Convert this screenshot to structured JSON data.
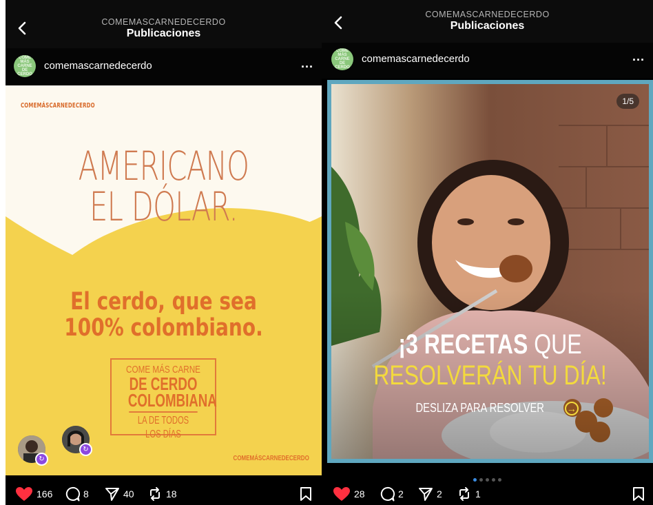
{
  "left": {
    "header": {
      "subtitle": "COMEMASCARNEDECERDO",
      "title": "Publicaciones"
    },
    "user": {
      "avatar_text": "COME MÁS CARNE DE CERDO",
      "username": "comemascarnedecerdo",
      "more": "..."
    },
    "post": {
      "brand_top": "COMEMÁSCARNEDECERDO",
      "headline": [
        "AMERICANO",
        "EL DÓLAR."
      ],
      "subheadline": [
        "El cerdo, que sea",
        "100% colombiano."
      ],
      "stamp": [
        "COME MÁS CARNE",
        "DE CERDO",
        "COLOMBIANA",
        "LA DE TODOS LOS DÍAS"
      ],
      "brand_bottom": "COMEMÁSCARNEDECERDO"
    },
    "actions": {
      "likes": "166",
      "comments": "8",
      "shares": "40",
      "reposts": "18"
    }
  },
  "right": {
    "header": {
      "subtitle": "COMEMASCARNEDECERDO",
      "title": "Publicaciones"
    },
    "user": {
      "avatar_text": "COME MÁS CARNE DE CERDO",
      "username": "comemascarnedecerdo",
      "more": "..."
    },
    "post": {
      "pager": "1/5",
      "title_bold": "¡3 RECETAS",
      "title_thin": " QUE",
      "title_line2": "RESOLVERÁN TU DÍA!",
      "swipe": "DESLIZA PARA RESOLVER",
      "swipe_arrow": "→"
    },
    "actions": {
      "likes": "28",
      "comments": "2",
      "shares": "2",
      "reposts": "1"
    }
  },
  "colors": {
    "post_yellow": "#f4d24e",
    "orange": "#e06f2b",
    "like_red": "#ff3040",
    "accent_yellow": "#f3da3d",
    "frame_blue": "#5fa7bf",
    "active_dot": "#3a8be0"
  },
  "icons": [
    "back-chevron-icon",
    "heart-icon",
    "comment-icon",
    "share-icon",
    "repost-icon",
    "bookmark-icon",
    "collab-badge-icon",
    "arrow-circle-icon"
  ]
}
